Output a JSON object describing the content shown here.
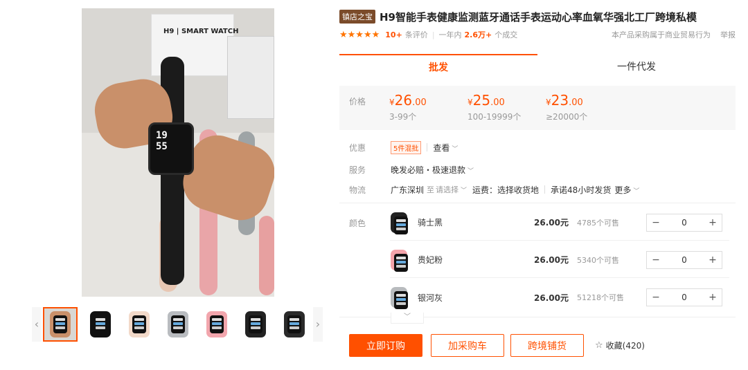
{
  "gallery": {
    "main_box_label": "H9 | SMART WATCH",
    "main_watch_time": "19\n55",
    "thumb_prev_icon": "‹",
    "thumb_next_icon": "›",
    "thumbnails": [
      {
        "kind": "video",
        "strap": "#d9d7d3"
      },
      {
        "kind": "image",
        "strap": "#111111"
      },
      {
        "kind": "image",
        "strap": "#f2d9c9"
      },
      {
        "kind": "image",
        "strap": "#b9bcc0"
      },
      {
        "kind": "image",
        "strap": "#f2a6ad"
      },
      {
        "kind": "image",
        "strap": "#222222"
      },
      {
        "kind": "image",
        "strap": "#2a2a2a"
      }
    ]
  },
  "product": {
    "shop_badge": "镇店之宝",
    "title": "H9智能手表健康监测蓝牙通话手表运动心率血氧华强北工厂跨境私模",
    "stars": "★★★★★",
    "review_count": "10+",
    "review_suffix": "条评价",
    "deal_prefix": "一年内",
    "deal_count": "2.6万+",
    "deal_suffix": "个成交",
    "commerce_note": "本产品采购属于商业贸易行为",
    "report": "举报"
  },
  "tabs": [
    {
      "label": "批发",
      "active": true
    },
    {
      "label": "一件代发",
      "active": false
    }
  ],
  "price": {
    "label": "价格",
    "tiers": [
      {
        "currency": "¥",
        "int": "26",
        "dec": ".00",
        "range": "3-99个"
      },
      {
        "currency": "¥",
        "int": "25",
        "dec": ".00",
        "range": "100-19999个"
      },
      {
        "currency": "¥",
        "int": "23",
        "dec": ".00",
        "range": "≥20000个"
      }
    ]
  },
  "promo": {
    "label": "优惠",
    "coupon": "5件混批",
    "view": "查看"
  },
  "service": {
    "label": "服务",
    "text": "晚发必赔・极速退款"
  },
  "logistics": {
    "label": "物流",
    "from": "广东深圳",
    "to_prefix": "至",
    "to_select": "请选择",
    "freight": "运费：选择收货地",
    "promise": "承诺48小时发货",
    "more": "更多"
  },
  "color": {
    "label": "颜色",
    "skus": [
      {
        "name": "骑士黑",
        "price": "26.00元",
        "stock": "4785个可售",
        "qty": "0",
        "swatch": "#222222"
      },
      {
        "name": "贵妃粉",
        "price": "26.00元",
        "stock": "5340个可售",
        "qty": "0",
        "swatch": "#f4a4aa"
      },
      {
        "name": "银河灰",
        "price": "26.00元",
        "stock": "51218个可售",
        "qty": "0",
        "swatch": "#b8bbbe"
      }
    ]
  },
  "stepper": {
    "minus": "−",
    "plus": "+"
  },
  "actions": {
    "buy": "立即订购",
    "cart": "加采购车",
    "cross": "跨境铺货",
    "fav": "收藏(420)"
  },
  "colors": {
    "accent": "#ff5000",
    "badge": "#7b4b2a"
  }
}
